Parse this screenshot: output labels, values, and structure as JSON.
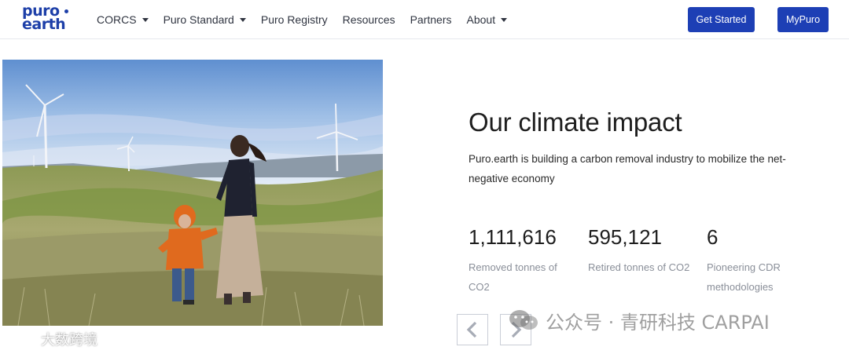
{
  "header": {
    "logo": {
      "line1": "puro",
      "line2": "earth"
    },
    "nav": [
      {
        "label": "CORCS",
        "dropdown": true
      },
      {
        "label": "Puro Standard",
        "dropdown": true
      },
      {
        "label": "Puro Registry",
        "dropdown": false
      },
      {
        "label": "Resources",
        "dropdown": false
      },
      {
        "label": "Partners",
        "dropdown": false
      },
      {
        "label": "About",
        "dropdown": true
      }
    ],
    "buttons": {
      "get_started": "Get Started",
      "mypuro": "MyPuro"
    }
  },
  "impact": {
    "title": "Our climate impact",
    "description": "Puro.earth is building a carbon removal industry to mobilize the net-negative economy",
    "stats": [
      {
        "value": "1,111,616",
        "label": "Removed tonnes of CO2"
      },
      {
        "value": "595,121",
        "label": "Retired tonnes of CO2"
      },
      {
        "value": "6",
        "label": "Pioneering CDR methodologies"
      }
    ]
  },
  "carousel": {
    "prev_icon": "chevron-left-icon",
    "next_icon": "chevron-right-icon"
  },
  "watermarks": {
    "right": "公众号 · 青研科技 CARPAI",
    "left": "大数跨境"
  },
  "colors": {
    "brand": "#1d3fa8",
    "button": "#1d3fb5",
    "muted_text": "#8a8f99"
  }
}
